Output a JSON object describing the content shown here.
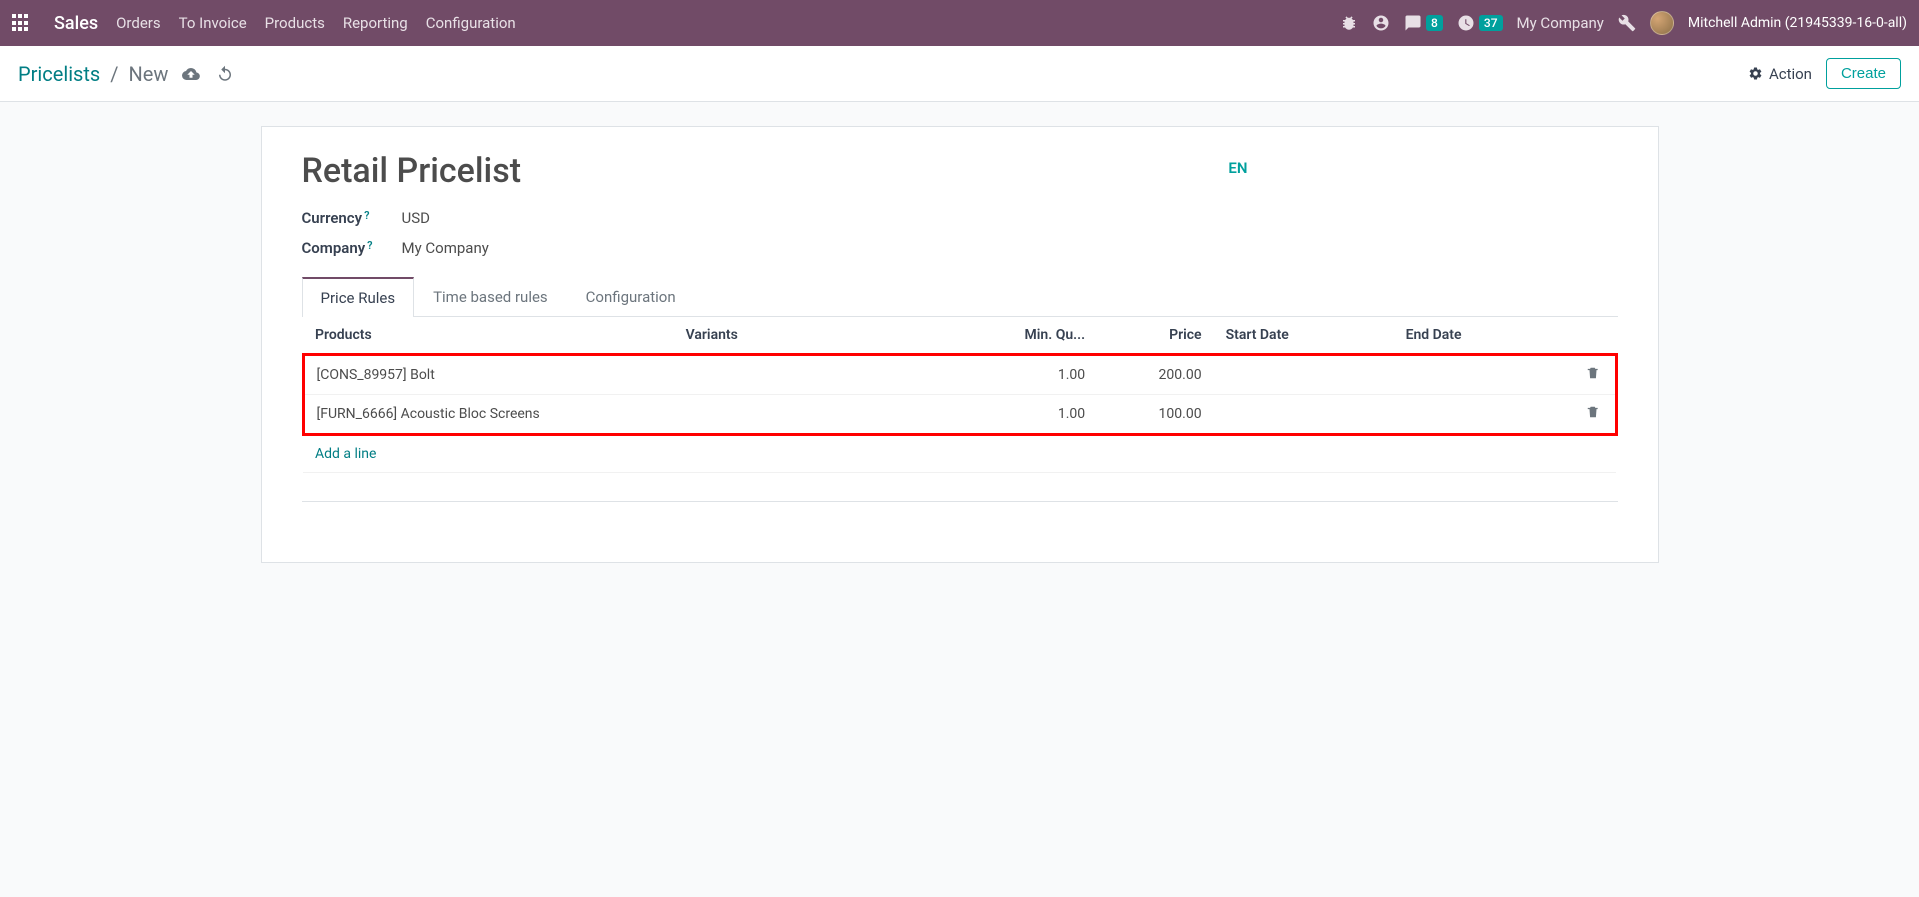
{
  "navbar": {
    "brand": "Sales",
    "menus": [
      "Orders",
      "To Invoice",
      "Products",
      "Reporting",
      "Configuration"
    ],
    "messages_badge": "8",
    "activities_badge": "37",
    "company": "My Company",
    "user": "Mitchell Admin (21945339-16-0-all)"
  },
  "control_panel": {
    "breadcrumb_root": "Pricelists",
    "breadcrumb_current": "New",
    "action_label": "Action",
    "create_label": "Create"
  },
  "form": {
    "title": "Retail Pricelist",
    "lang": "EN",
    "currency_label": "Currency",
    "currency_value": "USD",
    "company_label": "Company",
    "company_value": "My Company"
  },
  "tabs": [
    "Price Rules",
    "Time based rules",
    "Configuration"
  ],
  "table": {
    "headers": {
      "products": "Products",
      "variants": "Variants",
      "min_qty": "Min. Qu...",
      "price": "Price",
      "start_date": "Start Date",
      "end_date": "End Date"
    },
    "rows": [
      {
        "product": "[CONS_89957] Bolt",
        "variant": "",
        "min_qty": "1.00",
        "price": "200.00",
        "start": "",
        "end": ""
      },
      {
        "product": "[FURN_6666] Acoustic Bloc Screens",
        "variant": "",
        "min_qty": "1.00",
        "price": "100.00",
        "start": "",
        "end": ""
      }
    ],
    "add_line": "Add a line"
  }
}
